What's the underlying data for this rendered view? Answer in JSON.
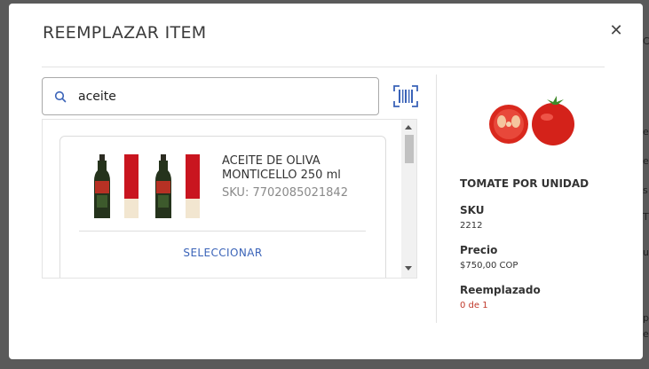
{
  "modal": {
    "title": "REEMPLAZAR ITEM",
    "close_icon": "close-icon"
  },
  "search": {
    "value": "aceite",
    "placeholder": "",
    "icon": "search-icon",
    "barcode_icon": "barcode-scan-icon"
  },
  "results": [
    {
      "name": "ACEITE DE OLIVA MONTICELLO 250 ml",
      "sku": "SKU: 7702085021842",
      "action_label": "SELECCIONAR"
    }
  ],
  "original_item": {
    "name": "TOMATE POR UNIDAD",
    "sku_label": "SKU",
    "sku_value": "2212",
    "price_label": "Precio",
    "price_value": "$750,00 COP",
    "replaced_label": "Reemplazado",
    "replaced_value": "0 de 1"
  },
  "colors": {
    "accent": "#3a63b8",
    "alert": "#c0392b",
    "overlay": "#5a5a5a"
  }
}
